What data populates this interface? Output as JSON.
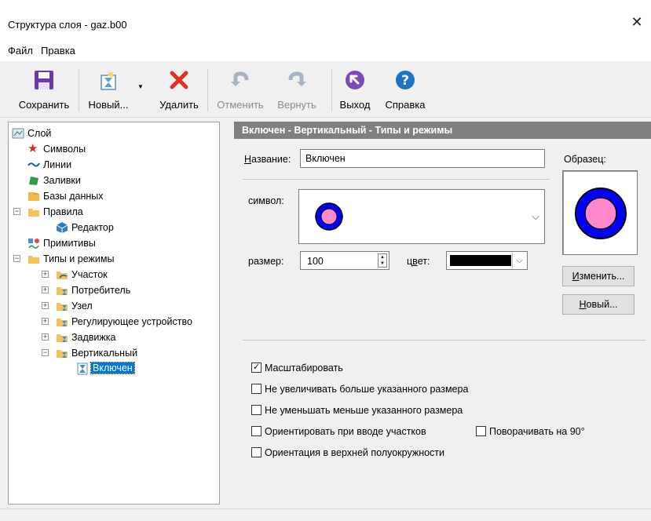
{
  "window": {
    "title": "Структура слоя - gaz.b00"
  },
  "menu": {
    "file": "Файл",
    "edit": "Правка"
  },
  "toolbar": {
    "save": "Сохранить",
    "new": "Новый...",
    "delete": "Удалить",
    "undo": "Отменить",
    "redo": "Вернуть",
    "exit": "Выход",
    "help": "Справка"
  },
  "tree": {
    "layer": "Слой",
    "symbols": "Символы",
    "lines": "Линии",
    "fills": "Заливки",
    "databases": "Базы данных",
    "rules": "Правила",
    "editor": "Редактор",
    "primitives": "Примитивы",
    "types": "Типы и режимы",
    "section": "Участок",
    "consumer": "Потребитель",
    "node": "Узел",
    "regulator": "Регулирующее устройство",
    "valve": "Задвижка",
    "vertical": "Вертикальный",
    "enabled": "Включен"
  },
  "panel": {
    "header": "Включен - Вертикальный - Типы и режимы",
    "name_label": "Название:",
    "name_value": "Включен",
    "symbol_label": "символ:",
    "size_label": "размер:",
    "size_value": "100",
    "color_label": "цвет:",
    "sample_label": "Образец:",
    "change_button": "Изменить...",
    "new_button": "Новый..."
  },
  "options": {
    "scale": "Масштабировать",
    "no_enlarge": "Не увеличивать больше указанного размера",
    "no_shrink": "Не уменьшать меньше указанного размера",
    "orient_input": "Ориентировать при вводе участков",
    "rotate90": "Поворачивать на 90°",
    "orient_upper": "Ориентация в верхней полуокружности"
  },
  "checked": {
    "scale": true,
    "no_enlarge": false,
    "no_shrink": false,
    "orient_input": false,
    "rotate90": false,
    "orient_upper": false
  },
  "colors": {
    "symbol_outer": "#0000ff",
    "symbol_inner": "#ff88cc",
    "symbol_outline": "#000000",
    "color_swatch": "#000000",
    "header_bg": "#808080"
  },
  "icons": [
    "save-icon",
    "new-icon",
    "delete-icon",
    "undo-icon",
    "redo-icon",
    "exit-icon",
    "help-icon",
    "close-icon"
  ]
}
